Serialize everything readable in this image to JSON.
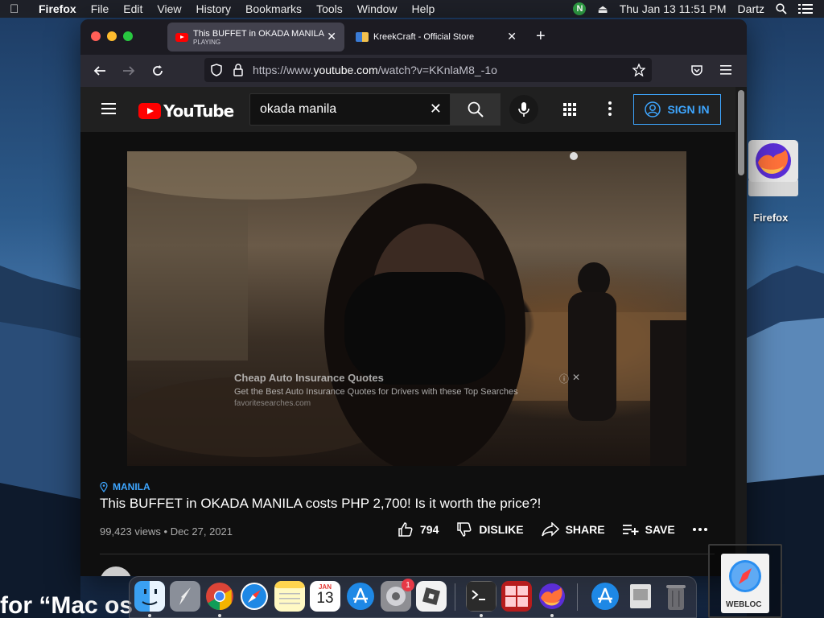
{
  "menubar": {
    "app_name": "Firefox",
    "items": [
      "File",
      "Edit",
      "View",
      "History",
      "Bookmarks",
      "Tools",
      "Window",
      "Help"
    ],
    "badge_letter": "N",
    "clock": "Thu Jan 13  11:51 PM",
    "user": "Dartz"
  },
  "browser": {
    "tabs": [
      {
        "title": "This BUFFET in OKADA MANILA",
        "status": "PLAYING"
      },
      {
        "title": "KreekCraft - Official Store"
      }
    ],
    "url": {
      "prefix": "https://www.",
      "host": "youtube.com",
      "rest": "/watch?v=KKnlaM8_-1o"
    }
  },
  "youtube": {
    "search_value": "okada manila",
    "sign_in_label": "SIGN IN",
    "ad": {
      "title": "Cheap Auto Insurance Quotes",
      "description": "Get the Best Auto Insurance Quotes for Drivers with these Top Searches",
      "url": "favoritesearches.com"
    },
    "location": "MANILA",
    "video_title": "This BUFFET in OKADA MANILA costs PHP 2,700! Is it worth the price?!",
    "views": "99,423 views",
    "date": "Dec 27, 2021",
    "likes": "794",
    "dislike_label": "DISLIKE",
    "share_label": "SHARE",
    "save_label": "SAVE"
  },
  "desktop": {
    "firefox_label": "Firefox",
    "webloc_label": "WEBLOC",
    "background_text": "for “Mac os"
  },
  "dock": {
    "calendar_month": "JAN",
    "calendar_day": "13",
    "settings_badge": "1"
  },
  "colors": {
    "youtube_red": "#ff0000",
    "link_blue": "#3ea6ff",
    "page_bg": "#0f0f0f"
  }
}
